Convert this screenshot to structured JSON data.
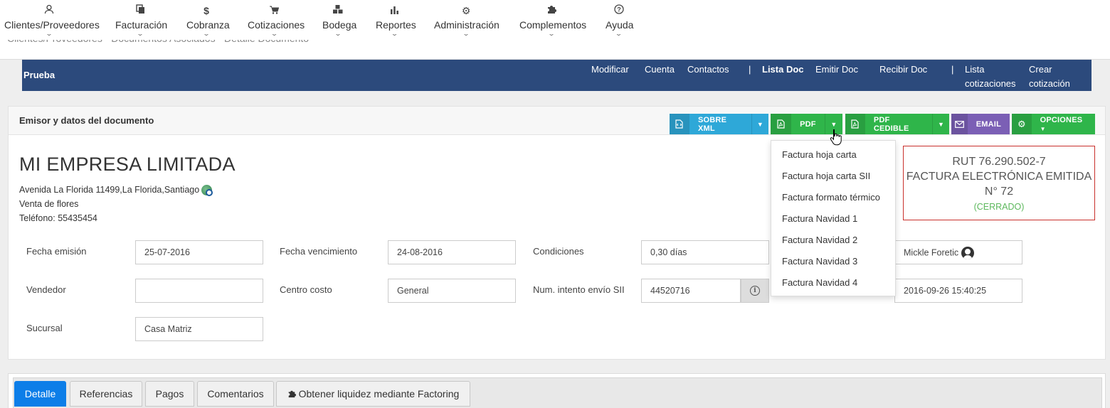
{
  "nav": [
    {
      "label": "Clientes/Proveedores",
      "icon": "users-icon"
    },
    {
      "label": "Facturación",
      "icon": "copy-icon"
    },
    {
      "label": "Cobranza",
      "icon": "dollar-icon"
    },
    {
      "label": "Cotizaciones",
      "icon": "cart-icon"
    },
    {
      "label": "Bodega",
      "icon": "cubes-icon"
    },
    {
      "label": "Reportes",
      "icon": "bar-chart-icon"
    },
    {
      "label": "Administración",
      "icon": "gears-icon"
    },
    {
      "label": "Complementos",
      "icon": "puzzle-icon"
    },
    {
      "label": "Ayuda",
      "icon": "question-icon"
    }
  ],
  "breadcrumb": "Clientes/Proveedores · Documentos Asociados · Detalle Documento",
  "header": {
    "brand": "Prueba",
    "links": [
      "Modificar",
      "Cuenta",
      "Contactos",
      "Lista Doc",
      "Emitir Doc",
      "Recibir Doc",
      "Lista cotizaciones",
      "Crear cotización"
    ],
    "separator": "|"
  },
  "panel": {
    "title": "Emisor y datos del documento",
    "buttons": {
      "xml": "SOBRE XML",
      "pdf": "PDF",
      "pdf_cedible": "PDF CEDIBLE",
      "email": "EMAIL",
      "opciones": "OPCIONES"
    },
    "company": {
      "name": "MI EMPRESA LIMITADA",
      "address": "Avenida La Florida 11499,La Florida,Santiago",
      "business": "Venta de flores",
      "phone": "Teléfono: 55435454"
    },
    "rut": {
      "line1": "RUT 76.290.502-7",
      "line2": "FACTURA ELECTRÓNICA EMITIDA",
      "line3": "N° 72",
      "status": "(CERRADO)"
    },
    "fields": {
      "fecha_emision_label": "Fecha emisión",
      "fecha_emision": "25-07-2016",
      "fecha_venc_label": "Fecha vencimiento",
      "fecha_venc": "24-08-2016",
      "condiciones_label": "Condiciones",
      "condiciones": "0,30 días",
      "usuario": "Mickle Foretic",
      "vendedor_label": "Vendedor",
      "vendedor": "",
      "centro_label": "Centro costo",
      "centro": "General",
      "intento_label": "Num. intento envío SII",
      "intento": "44520716",
      "fecha_envio": "2016-09-26 15:40:25",
      "sucursal_label": "Sucursal",
      "sucursal": "Casa Matriz"
    },
    "pdf_menu": [
      "Factura hoja carta",
      "Factura hoja carta SII",
      "Factura formato térmico",
      "Factura Navidad 1",
      "Factura Navidad 2",
      "Factura Navidad 3",
      "Factura Navidad 4"
    ]
  },
  "tabs": [
    "Detalle",
    "Referencias",
    "Pagos",
    "Comentarios",
    "Obtener liquidez mediante Factoring"
  ],
  "colors": {
    "navy": "#2c4a7c",
    "btn_blue": "#2ea8d8",
    "btn_green": "#2fb54a",
    "btn_purple": "#7b5fb5",
    "closed_green": "#5cb85c",
    "rut_border": "#c9302c",
    "tab_active": "#0d7ee8"
  }
}
